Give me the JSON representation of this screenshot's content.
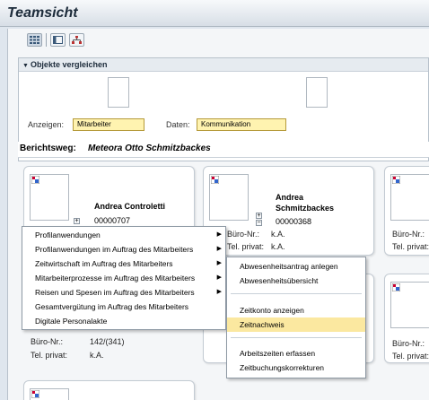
{
  "window": {
    "title": "Teamsicht"
  },
  "toolbar": {
    "icons": [
      "grid-view-icon",
      "list-view-icon",
      "org-chart-icon"
    ]
  },
  "compare": {
    "header": "Objekte vergleichen"
  },
  "filters": {
    "show_label": "Anzeigen:",
    "show_value": "Mitarbeiter",
    "data_label": "Daten:",
    "data_value": "Kommunikation"
  },
  "path": {
    "label": "Berichtsweg:",
    "value": "Meteora Otto Schmitzbackes"
  },
  "cards": [
    {
      "name": "Andrea Controletti",
      "number": "00000707"
    },
    {
      "name_line1": "Andrea",
      "name_line2": "Schmitzbackes",
      "number": "00000368",
      "office_label": "Büro-Nr.:",
      "office_value": "k.A.",
      "phone_label": "Tel. privat:",
      "phone_value": "k.A."
    },
    {
      "office_label": "Büro-Nr.:",
      "phone_label": "Tel. privat:"
    },
    {
      "office_label": "Büro-Nr.:",
      "office_value": "142/(341)",
      "phone_label": "Tel. privat:",
      "phone_value": "k.A."
    },
    {
      "office_label": "Büro-Nr.:",
      "phone_label": "Tel. privat:"
    }
  ],
  "context_menu": [
    "Profilanwendungen",
    "Profilanwendungen im Auftrag des Mitarbeiters",
    "Zeitwirtschaft im Auftrag des Mitarbeiters",
    "Mitarbeiterprozesse im Auftrag des Mitarbeiters",
    "Reisen und Spesen im Auftrag des Mitarbeiters",
    "Gesamtvergütung im Auftrag des Mitarbeiters",
    "Digitale Personalakte"
  ],
  "submenu": [
    "Abwesenheitsantrag anlegen",
    "Abwesenheitsübersicht",
    "Zeitkonto anzeigen",
    "Zeitnachweis",
    "Arbeitszeiten erfassen",
    "Zeitbuchungskorrekturen"
  ],
  "colors": {
    "highlight": "#fbe8a0",
    "dropdown": "#fff3b0"
  }
}
